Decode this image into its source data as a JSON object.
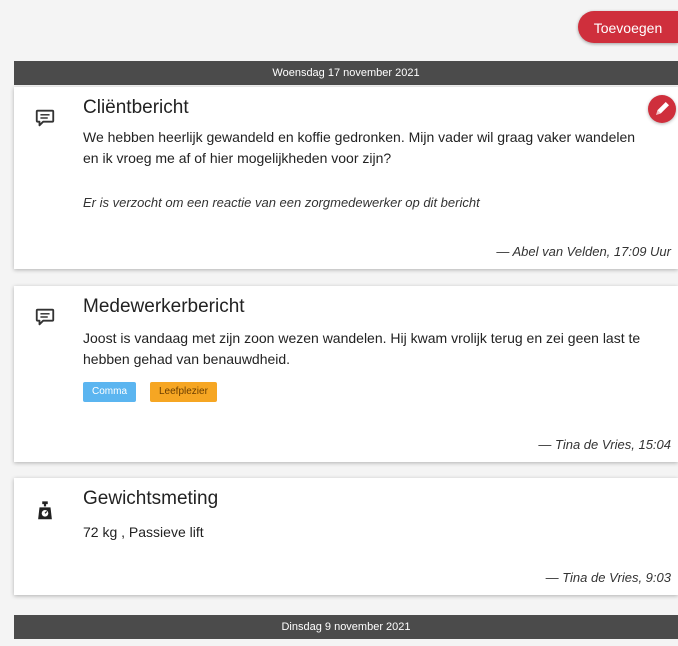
{
  "toolbar": {
    "add_label": "Toevoegen"
  },
  "days": [
    {
      "date_label": "Woensdag 17 november 2021"
    },
    {
      "date_label": "Dinsdag 9 november 2021"
    }
  ],
  "entries": [
    {
      "type_icon": "chat-bubble-icon",
      "title": "Cliëntbericht",
      "text": "We hebben heerlijk gewandeld en koffie gedronken. Mijn vader wil graag vaker wandelen en ik vroeg me af of hier mogelijkheden voor zijn?",
      "note": "Er is verzocht om een reactie van een zorgmedewerker op dit bericht",
      "author": "— Abel van Velden, 17:09 Uur"
    },
    {
      "type_icon": "chat-bubble-icon",
      "title": "Medewerkerbericht",
      "text": "Joost is vandaag met zijn zoon wezen wandelen. Hij kwam vrolijk terug en zei geen last te hebben gehad van benauwdheid.",
      "tags": [
        "Comma",
        "Leefplezier"
      ],
      "author": "— Tina de Vries, 15:04"
    },
    {
      "type_icon": "weight-scale-icon",
      "title": "Gewichtsmeting",
      "text": "72 kg , Passieve lift",
      "author": "— Tina de Vries, 9:03"
    }
  ],
  "colors": {
    "accent": "#cf2f3c",
    "date_bar": "#4b4b4b",
    "tag_blue": "#5bb5f0",
    "tag_orange": "#f6a623"
  }
}
